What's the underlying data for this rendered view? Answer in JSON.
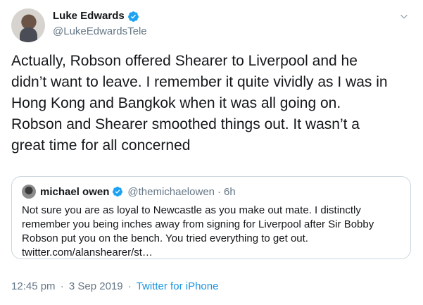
{
  "author": {
    "name": "Luke Edwards",
    "handle": "@LukeEdwardsTele"
  },
  "tweet": {
    "text": "Actually, Robson offered Shearer to Liverpool and he\ndidn’t want to leave. I remember it quite vividly as I was in\nHong Kong and Bangkok when it was all going on.\nRobson and Shearer smoothed things out. It wasn’t a\ngreat time for all concerned"
  },
  "quoted": {
    "name": "michael owen",
    "handle": "@themichaelowen",
    "separator": "·",
    "time": "6h",
    "text": "Not sure you are as loyal to Newcastle as you make out mate. I distinctly\nremember you being inches away from signing for Liverpool after Sir Bobby\nRobson put you on the bench. You tried everything to get out.\ntwitter.com/alanshearer/st…"
  },
  "footer": {
    "time": "12:45 pm",
    "sep1": "·",
    "date": "3 Sep 2019",
    "sep2": "·",
    "source": "Twitter for iPhone"
  },
  "colors": {
    "verified": "#1da1f2",
    "link": "#1b95e0",
    "muted": "#657786",
    "border": "#ccd6dd"
  },
  "icons": [
    "verified-badge-icon",
    "chevron-down-icon"
  ]
}
